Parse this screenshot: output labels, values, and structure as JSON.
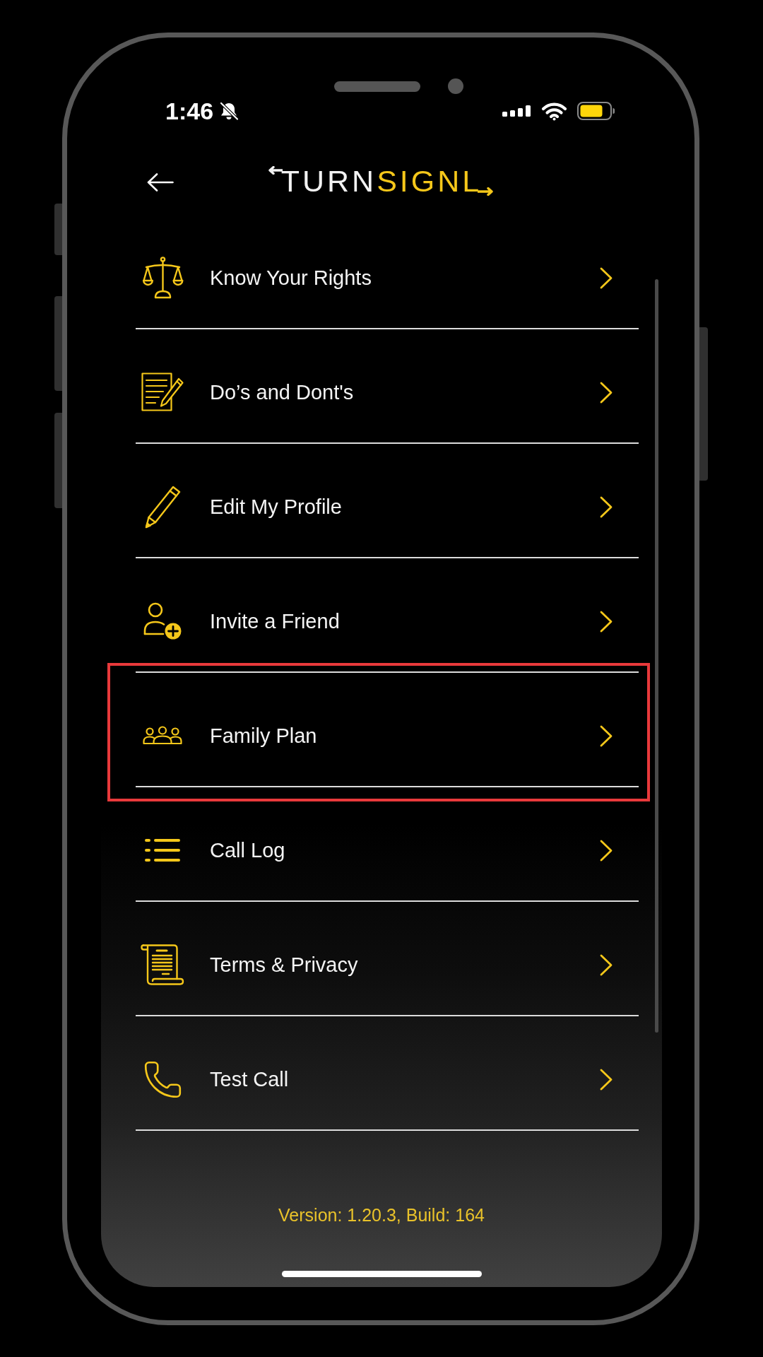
{
  "status_bar": {
    "time": "1:46"
  },
  "header": {
    "logo": [
      "TURN",
      "SIGNL"
    ]
  },
  "menu": [
    {
      "label": "Know Your Rights",
      "highlighted": false
    },
    {
      "label": "Do’s and Dont's",
      "highlighted": false
    },
    {
      "label": "Edit My Profile",
      "highlighted": false
    },
    {
      "label": "Invite a Friend",
      "highlighted": false
    },
    {
      "label": "Family Plan",
      "highlighted": true
    },
    {
      "label": "Call Log",
      "highlighted": false
    },
    {
      "label": "Terms & Privacy",
      "highlighted": false
    },
    {
      "label": "Test Call",
      "highlighted": false
    }
  ],
  "footer": {
    "version": "Version: 1.20.3, Build: 164"
  }
}
